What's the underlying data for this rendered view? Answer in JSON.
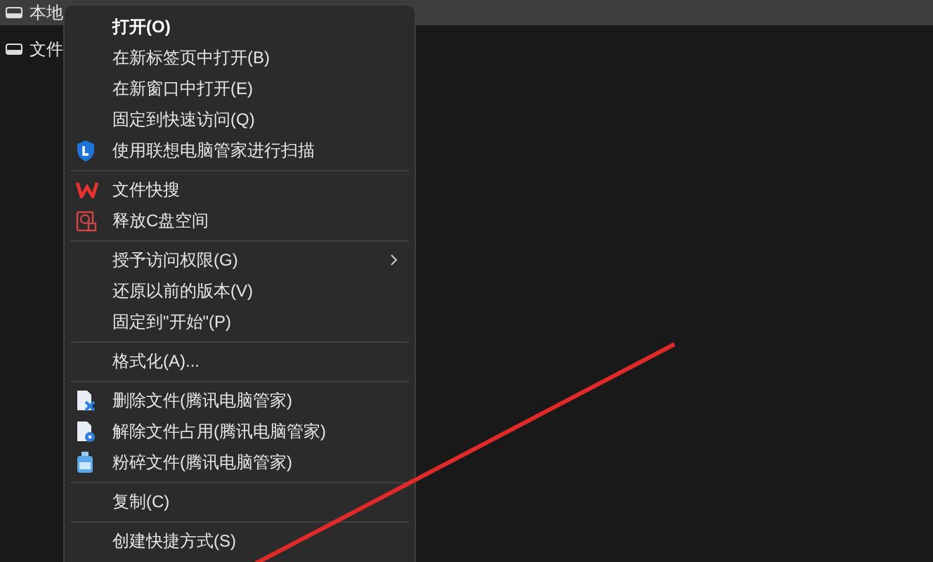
{
  "sidebar": {
    "items": [
      {
        "label": "本地",
        "selected": true
      },
      {
        "label": "文件",
        "selected": false
      }
    ]
  },
  "context_menu": {
    "items": [
      {
        "kind": "plain",
        "label": "打开(O)",
        "default": true
      },
      {
        "kind": "plain",
        "label": "在新标签页中打开(B)",
        "default": false
      },
      {
        "kind": "plain",
        "label": "在新窗口中打开(E)",
        "default": false
      },
      {
        "kind": "plain",
        "label": "固定到快速访问(Q)",
        "default": false
      },
      {
        "kind": "shield",
        "label": "使用联想电脑管家进行扫描",
        "default": false
      },
      {
        "kind": "separator"
      },
      {
        "kind": "wlogo",
        "label": "文件快搜",
        "default": false
      },
      {
        "kind": "cleanup",
        "label": "释放C盘空间",
        "default": false
      },
      {
        "kind": "separator"
      },
      {
        "kind": "plain",
        "label": "授予访问权限(G)",
        "default": false,
        "submenu": true
      },
      {
        "kind": "plain",
        "label": "还原以前的版本(V)",
        "default": false
      },
      {
        "kind": "plain",
        "label": "固定到\"开始\"(P)",
        "default": false
      },
      {
        "kind": "separator"
      },
      {
        "kind": "plain",
        "label": "格式化(A)...",
        "default": false
      },
      {
        "kind": "separator"
      },
      {
        "kind": "filedelete",
        "label": "删除文件(腾讯电脑管家)",
        "default": false
      },
      {
        "kind": "fileunlock",
        "label": "解除文件占用(腾讯电脑管家)",
        "default": false
      },
      {
        "kind": "bottle",
        "label": "粉碎文件(腾讯电脑管家)",
        "default": false
      },
      {
        "kind": "separator"
      },
      {
        "kind": "plain",
        "label": "复制(C)",
        "default": false
      },
      {
        "kind": "separator"
      },
      {
        "kind": "plain",
        "label": "创建快捷方式(S)",
        "default": false
      }
    ]
  }
}
